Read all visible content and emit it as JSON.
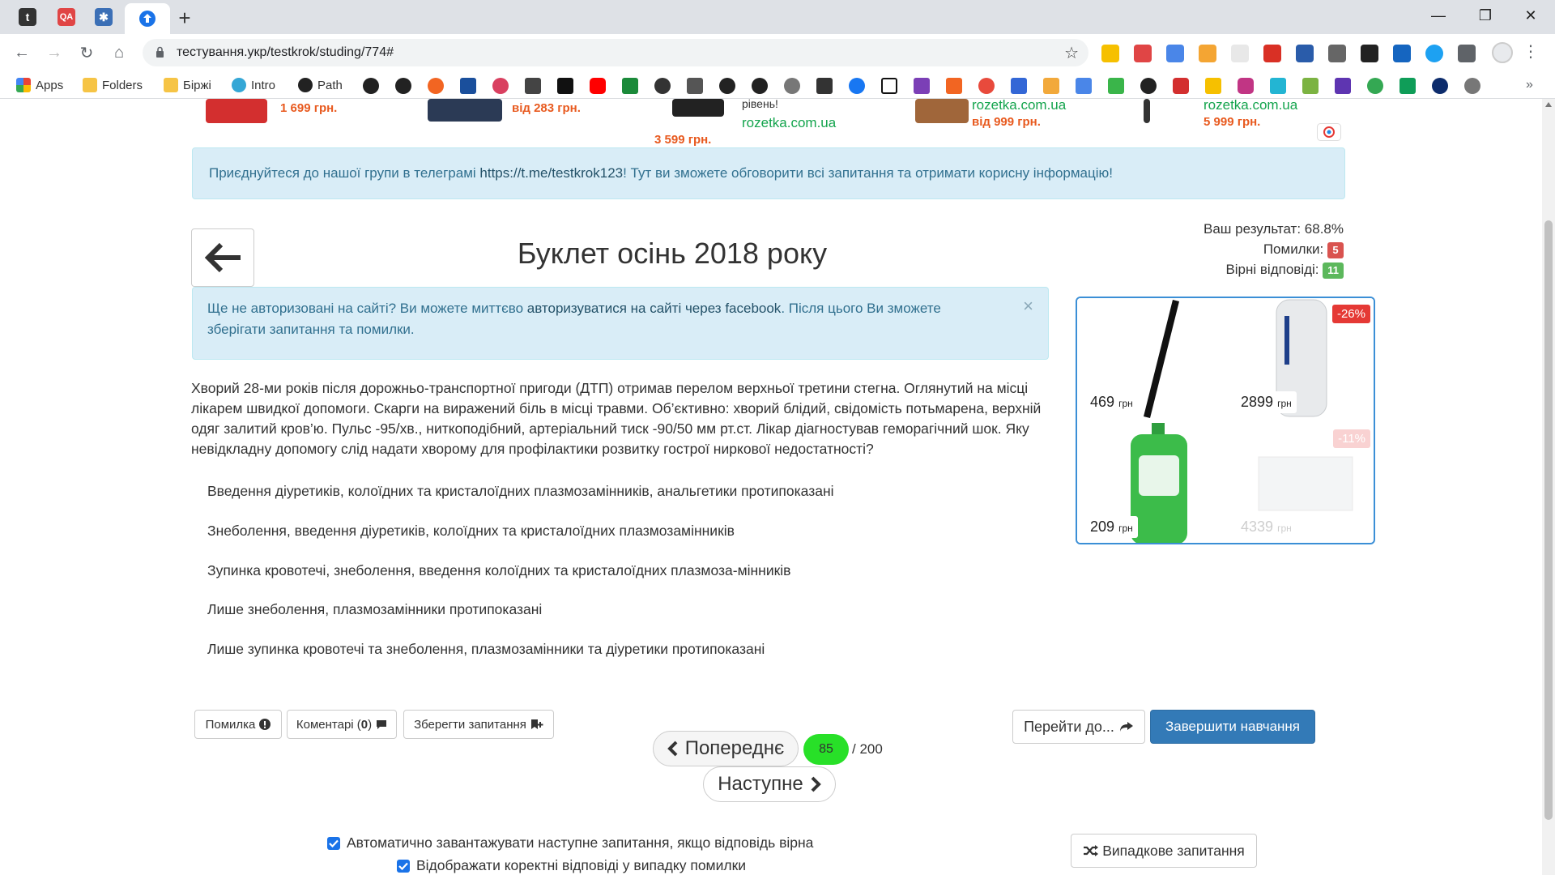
{
  "browser": {
    "url": "тестування.укр/testkrok/studing/774#",
    "tabs": [
      "t",
      "QA",
      "",
      ""
    ],
    "bookmarks": [
      {
        "label": "Apps"
      },
      {
        "label": "Folders"
      },
      {
        "label": "Біржі"
      },
      {
        "label": "Intro"
      },
      {
        "label": "Path"
      }
    ]
  },
  "ads": [
    {
      "price": "1 699 грн."
    },
    {
      "price": "від 283 грн."
    },
    {
      "price": "3 599 грн.",
      "text": "рівень!",
      "link": "rozetka.com.ua"
    },
    {
      "price": "від 999 грн.",
      "link": "rozetka.com.ua"
    },
    {
      "price": "5 999 грн.",
      "link": "rozetka.com.ua"
    }
  ],
  "telegram_alert": {
    "text_before": "Приєднуйтеся до нашої групи в телеграмі ",
    "link": "https://t.me/testkrok123",
    "text_after": "! Тут ви зможете обговорити всі запитання та отримати корисну інформацію!"
  },
  "page_title": "Буклет осінь 2018 року",
  "result": {
    "score_label": "Ваш результат: 68.8%",
    "errors_label": "Помилки:",
    "errors_count": "5",
    "correct_label": "Вірні відповіді:",
    "correct_count": "11"
  },
  "auth_alert": {
    "text_before": "Ще не авторизовані на сайті? Ви можете миттєво ",
    "link": "авторизуватися на сайті через facebook",
    "text_after": ". Після цього Ви зможете зберігати запитання та помилки.",
    "close": "×"
  },
  "question": "Хворий 28-ми років після дорожньо-транспортної пригоди (ДТП) отримав перелом верхньої третини стегна. Оглянутий на місці лікарем швидкої допомоги. Скарги на виражений біль в місці травми. Об’єктивно: хворий блідий, свідомість потьмарена, верхній одяг залитий кров’ю. Пульс -95/хв., ниткоподібний, артеріальний тиск -90/50 мм рт.ст. Лікар діагностував геморагічний шок. Яку невідкладну допомогу слід надати хворому для профілактики розвитку гострої ниркової недостатності?",
  "answers": [
    "Введення діуретиків, колоїдних та кристалоїдних плазмозамінників, анальгетики протипоказані",
    "Знеболення, введення діуретиків, колоїдних та кристалоїдних плазмозамінників",
    "Зупинка кровотечі, знеболення, введення колоїдних та кристалоїдних плазмоза-мінників",
    "Лише знеболення, плазмозамінники протипоказані",
    "Лише зупинка кровотечі та знеболення, плазмозамінники та діуретики протипоказані"
  ],
  "products": [
    {
      "price": "469",
      "unit": "грн"
    },
    {
      "price": "2899",
      "unit": "грн",
      "discount": "-26%"
    },
    {
      "price": "209",
      "unit": "грн"
    },
    {
      "price": "4339",
      "unit": "грн",
      "discount": "-11%"
    }
  ],
  "actions": {
    "error": "Помилка",
    "comments": "Коментарі (",
    "comments_count": "0",
    "comments_close": ")",
    "save": "Зберегти запитання",
    "prev": "Попереднє",
    "next": "Наступне",
    "current": "85",
    "total": "/ 200",
    "goto": "Перейти до...",
    "finish": "Завершити навчання",
    "random": "Випадкове запитання"
  },
  "options": {
    "autoload": "Автоматично завантажувати наступне запитання, якщо відповідь вірна",
    "show_correct": "Відображати коректні відповіді у випадку помилки"
  },
  "colors": {
    "alert_bg": "#d9edf7",
    "alert_text": "#31708f",
    "primary": "#337ab7",
    "counter": "#28e028",
    "error_badge": "#d9534f",
    "success_badge": "#5cb85c"
  }
}
